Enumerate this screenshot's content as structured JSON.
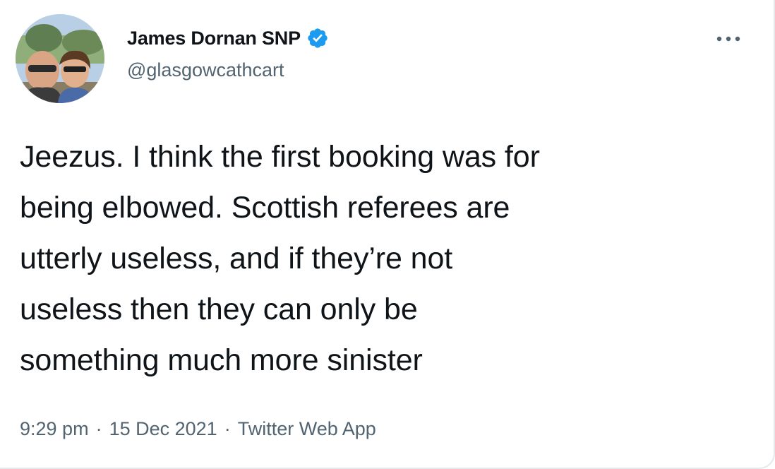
{
  "author": {
    "display_name": "James Dornan SNP",
    "handle": "@glasgowcathcart",
    "verified": true
  },
  "tweet": {
    "lines": [
      "Jeezus. I think the first booking was for",
      "being elbowed. Scottish referees are",
      "utterly useless, and if they’re not",
      "useless then they can only be",
      "something much more sinister"
    ]
  },
  "meta": {
    "time": "9:29 pm",
    "separator": "·",
    "date": "15 Dec 2021",
    "source": "Twitter Web App"
  },
  "icons": {
    "verified": "verified-badge-icon",
    "more": "more-options-icon"
  },
  "colors": {
    "text": "#0f1419",
    "secondary": "#536471",
    "verified_blue": "#1d9bf0"
  }
}
